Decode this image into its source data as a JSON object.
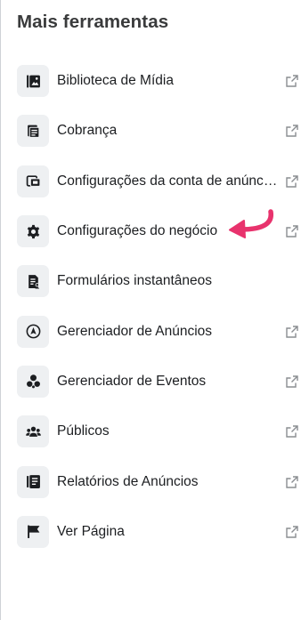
{
  "panel": {
    "title": "Mais ferramentas"
  },
  "menu": {
    "items": [
      {
        "label": "Biblioteca de Mídia",
        "icon": "media-library-icon",
        "external": true
      },
      {
        "label": "Cobrança",
        "icon": "billing-icon",
        "external": true
      },
      {
        "label": "Configurações da conta de anúncios",
        "icon": "ad-account-settings-icon",
        "external": true
      },
      {
        "label": "Configurações do negócio",
        "icon": "gear-icon",
        "external": true
      },
      {
        "label": "Formulários instantâneos",
        "icon": "instant-form-icon",
        "external": false
      },
      {
        "label": "Gerenciador de Anúncios",
        "icon": "ads-manager-icon",
        "external": true
      },
      {
        "label": "Gerenciador de Eventos",
        "icon": "events-manager-icon",
        "external": true
      },
      {
        "label": "Públicos",
        "icon": "audiences-icon",
        "external": true
      },
      {
        "label": "Relatórios de Anúncios",
        "icon": "ads-reporting-icon",
        "external": true
      },
      {
        "label": "Ver Página",
        "icon": "flag-icon",
        "external": true
      }
    ]
  },
  "colors": {
    "text": "#1c1e21",
    "icon": "#1c1e21",
    "icon_bg": "#eef0f2",
    "external_icon": "#8a8d91",
    "annotation_arrow": "#e8336d"
  }
}
